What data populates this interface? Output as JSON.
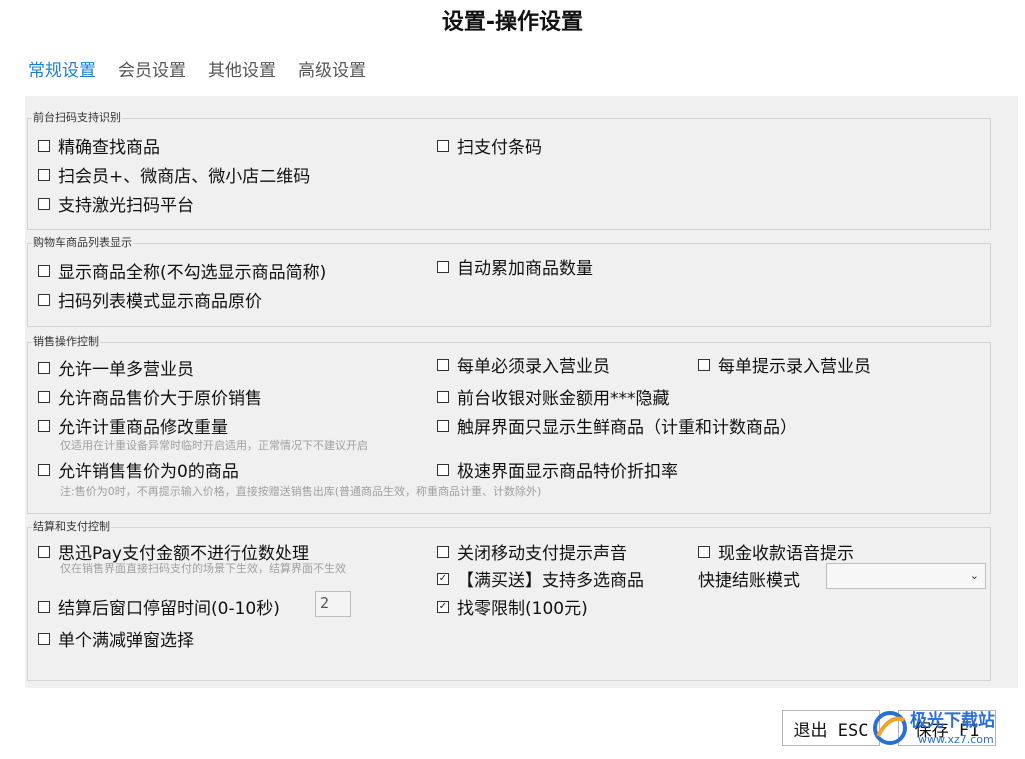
{
  "window": {
    "title": "设置-操作设置"
  },
  "tabs": [
    {
      "label": "常规设置",
      "active": true
    },
    {
      "label": "会员设置",
      "active": false
    },
    {
      "label": "其他设置",
      "active": false
    },
    {
      "label": "高级设置",
      "active": false
    }
  ],
  "scan_group": {
    "title": "前台扫码支持识别",
    "precise_search": {
      "label": "精确查找商品",
      "checked": false
    },
    "scan_pay_code": {
      "label": "扫支付条码",
      "checked": false
    },
    "scan_member_qr": {
      "label": "扫会员+、微商店、微小店二维码",
      "checked": false
    },
    "laser_scan": {
      "label": "支持激光扫码平台",
      "checked": false
    }
  },
  "cart_group": {
    "title": "购物车商品列表显示",
    "full_name": {
      "label": "显示商品全称(不勾选显示商品简称)",
      "checked": false
    },
    "auto_accumulate": {
      "label": "自动累加商品数量",
      "checked": false
    },
    "scan_list_original_price": {
      "label": "扫码列表模式显示商品原价",
      "checked": false
    }
  },
  "sales_group": {
    "title": "销售操作控制",
    "multi_clerk": {
      "label": "允许一单多营业员",
      "checked": false
    },
    "must_enter_clerk": {
      "label": "每单必须录入营业员",
      "checked": false
    },
    "prompt_clerk": {
      "label": "每单提示录入营业员",
      "checked": false
    },
    "price_above_original": {
      "label": "允许商品售价大于原价销售",
      "checked": false
    },
    "hide_reconcile_amount": {
      "label": "前台收银对账金额用***隐藏",
      "checked": false
    },
    "edit_weight": {
      "label": "允许计重商品修改重量",
      "checked": false
    },
    "edit_weight_hint": "仅适用在计重设备异常时临时开启适用，正常情况下不建议开启",
    "touch_fresh_only": {
      "label": "触屏界面只显示生鲜商品（计重和计数商品）",
      "checked": false
    },
    "zero_price": {
      "label": "允许销售售价为0的商品",
      "checked": false
    },
    "zero_price_hint": "注:售价为0时，不再提示输入价格，直接按赠送销售出库(普通商品生效，称重商品计重、计数除外)",
    "express_discount_rate": {
      "label": "极速界面显示商品特价折扣率",
      "checked": false
    }
  },
  "payment_group": {
    "title": "结算和支付控制",
    "pay_no_rounding": {
      "label": "思迅Pay支付金额不进行位数处理",
      "checked": false
    },
    "pay_no_rounding_hint": "仅在销售界面直接扫码支付的场景下生效，结算界面不生效",
    "mute_mobile_pay": {
      "label": "关闭移动支付提示声音",
      "checked": false
    },
    "cash_voice": {
      "label": "现金收款语音提示",
      "checked": false
    },
    "full_gift_multi": {
      "label": "【满买送】支持多选商品",
      "checked": true
    },
    "quick_checkout_label": "快捷结账模式",
    "quick_checkout_value": "",
    "window_stay": {
      "label": "结算后窗口停留时间(0-10秒)",
      "checked": false,
      "value": "2"
    },
    "change_limit": {
      "label": "找零限制(100元)",
      "checked": true
    },
    "single_discount_popup": {
      "label": "单个满减弹窗选择",
      "checked": false
    }
  },
  "footer": {
    "exit_label": "退出 ESC",
    "save_label": "保存 F1"
  },
  "watermark": {
    "text": "极光下载站",
    "url": "www.xz7.com"
  },
  "colors": {
    "accent": "#1a7fd4",
    "panel_bg": "#f0f0f0",
    "hint": "#a0a0a0"
  }
}
